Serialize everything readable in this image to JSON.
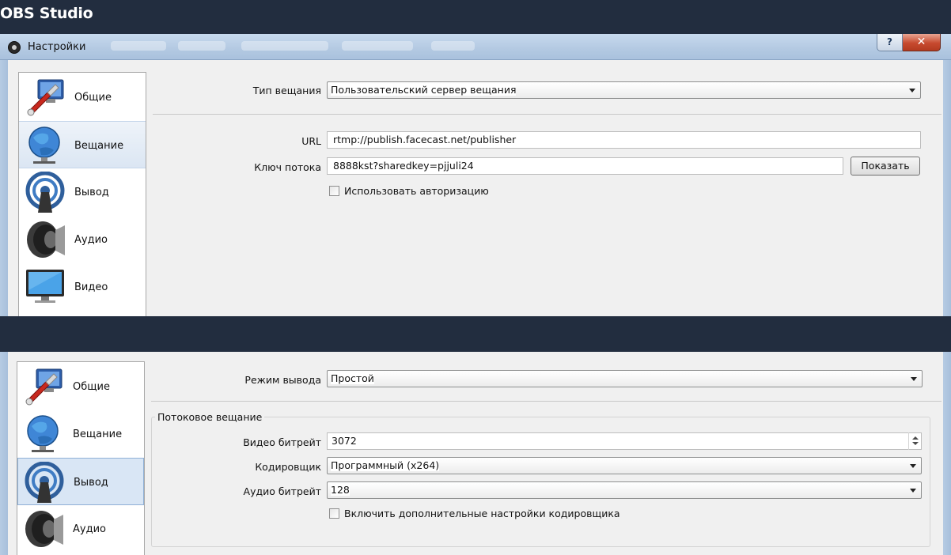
{
  "banner": {
    "title": "OBS Studio"
  },
  "window": {
    "title": "Настройки",
    "help_label": "?",
    "close_label": "✕"
  },
  "sidebar_top": {
    "items": [
      {
        "label": "Общие",
        "icon": "general-icon"
      },
      {
        "label": "Вещание",
        "icon": "stream-globe-icon"
      },
      {
        "label": "Вывод",
        "icon": "output-broadcast-icon"
      },
      {
        "label": "Аудио",
        "icon": "speaker-icon"
      },
      {
        "label": "Видео",
        "icon": "monitor-icon"
      }
    ]
  },
  "stream": {
    "service_type_label": "Тип вещания",
    "service_type_value": "Пользовательский сервер вещания",
    "url_label": "URL",
    "url_value": "rtmp://publish.facecast.net/publisher",
    "key_label": "Ключ потока",
    "key_value": "8888kst?sharedkey=pjjuli24",
    "show_button": "Показать",
    "use_auth_label": "Использовать авторизацию"
  },
  "sidebar_bottom": {
    "items": [
      {
        "label": "Общие",
        "icon": "general-icon"
      },
      {
        "label": "Вещание",
        "icon": "stream-globe-icon"
      },
      {
        "label": "Вывод",
        "icon": "output-broadcast-icon"
      },
      {
        "label": "Аудио",
        "icon": "speaker-icon"
      }
    ]
  },
  "output": {
    "mode_label": "Режим вывода",
    "mode_value": "Простой",
    "group_title": "Потоковое вещание",
    "video_bitrate_label": "Видео битрейт",
    "video_bitrate_value": "3072",
    "encoder_label": "Кодировщик",
    "encoder_value": "Программный (x264)",
    "audio_bitrate_label": "Аудио битрейт",
    "audio_bitrate_value": "128",
    "advanced_encoder_label": "Включить дополнительные настройки кодировщика"
  },
  "colors": {
    "banner_bg": "#222d3f",
    "dialog_bg": "#f0f0f0",
    "selection_bg": "#d9e6f5",
    "close_button": "#c74a2f"
  }
}
